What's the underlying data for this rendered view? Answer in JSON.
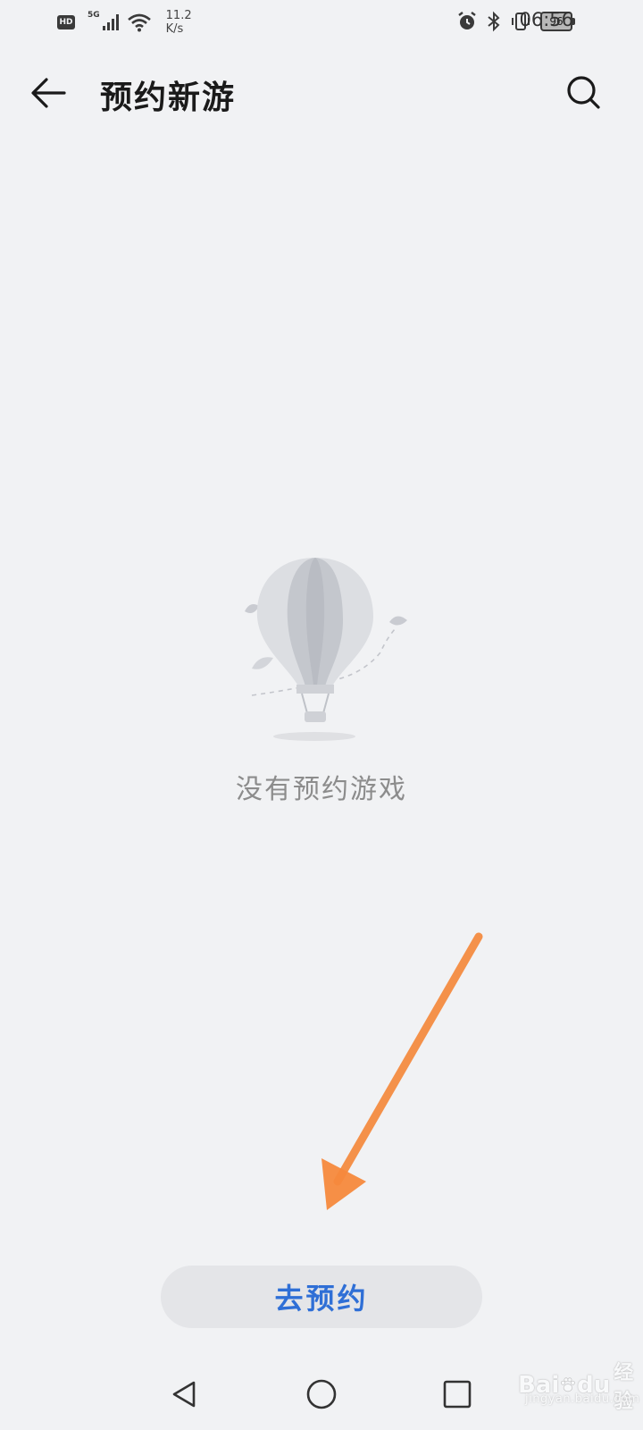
{
  "status_bar": {
    "hd_label": "HD",
    "network_label": "5G",
    "speed_value": "11.2",
    "speed_unit": "K/s",
    "battery_level": "96",
    "time": "06:56",
    "icons": [
      "hd-icon",
      "signal-icon",
      "wifi-icon",
      "alarm-icon",
      "bluetooth-icon",
      "vibrate-icon",
      "battery-icon"
    ]
  },
  "app_bar": {
    "title": "预约新游",
    "back_icon": "arrow-left-icon",
    "search_icon": "search-icon"
  },
  "empty_state": {
    "illustration": "hot-air-balloon-icon",
    "message": "没有预约游戏"
  },
  "action": {
    "button_label": "去预约",
    "accent_color": "#2f6fd6"
  },
  "annotation": {
    "type": "arrow",
    "color": "#f5893c",
    "points_to": "action button"
  },
  "nav_bar": {
    "items": [
      {
        "name": "back",
        "icon": "triangle-back-icon"
      },
      {
        "name": "home",
        "icon": "circle-home-icon"
      },
      {
        "name": "recents",
        "icon": "square-recents-icon"
      }
    ]
  },
  "watermark": {
    "brand": "Bai",
    "brand_suffix": "du",
    "cn_label": "经验",
    "url": "jingyan.baidu.com"
  }
}
